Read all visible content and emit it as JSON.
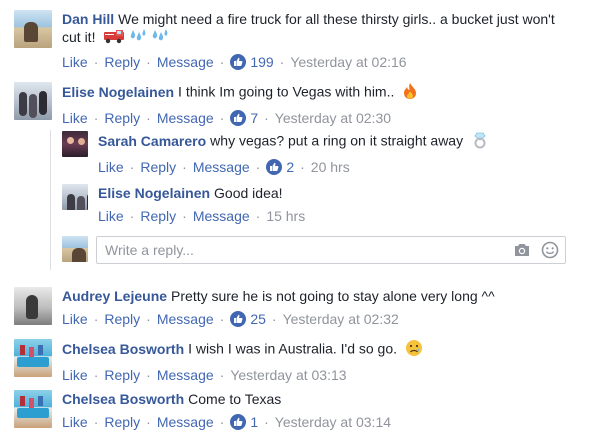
{
  "comments": [
    {
      "author": "Dan Hill",
      "text": "We might need a fire truck for all these thirsty girls.. a bucket just won't cut it!",
      "emojis": [
        "fire-truck-emoji",
        "water-drops-emoji",
        "water-drops-emoji"
      ],
      "like_label": "Like",
      "reply_label": "Reply",
      "message_label": "Message",
      "likes": "199",
      "time": "Yesterday at 02:16"
    },
    {
      "author": "Elise Nogelainen",
      "text": "I think Im going to Vegas with him..",
      "emojis": [
        "fire-emoji"
      ],
      "like_label": "Like",
      "reply_label": "Reply",
      "message_label": "Message",
      "likes": "7",
      "time": "Yesterday at 02:30",
      "replies": [
        {
          "author": "Sarah Camarero",
          "text": "why vegas? put a ring on it straight away",
          "emojis": [
            "ring-emoji"
          ],
          "like_label": "Like",
          "reply_label": "Reply",
          "message_label": "Message",
          "likes": "2",
          "time": "20 hrs"
        },
        {
          "author": "Elise Nogelainen",
          "text": "Good idea!",
          "like_label": "Like",
          "reply_label": "Reply",
          "message_label": "Message",
          "time": "15 hrs"
        }
      ],
      "reply_placeholder": "Write a reply..."
    },
    {
      "author": "Audrey Lejeune",
      "text": "Pretty sure he is not going to stay alone very long ^^",
      "like_label": "Like",
      "reply_label": "Reply",
      "message_label": "Message",
      "likes": "25",
      "time": "Yesterday at 02:32"
    },
    {
      "author": "Chelsea Bosworth",
      "text": "I wish I was in Australia. I'd so go.",
      "emojis": [
        "sad-face-emoji"
      ],
      "like_label": "Like",
      "reply_label": "Reply",
      "message_label": "Message",
      "time": "Yesterday at 03:13"
    },
    {
      "author": "Chelsea Bosworth",
      "text": "Come to Texas",
      "like_label": "Like",
      "reply_label": "Reply",
      "message_label": "Message",
      "likes": "1",
      "time": "Yesterday at 03:14"
    }
  ],
  "colors": {
    "author": "#365899",
    "link": "#4267b2",
    "muted": "#90949c",
    "like_badge": "#4267b2"
  }
}
